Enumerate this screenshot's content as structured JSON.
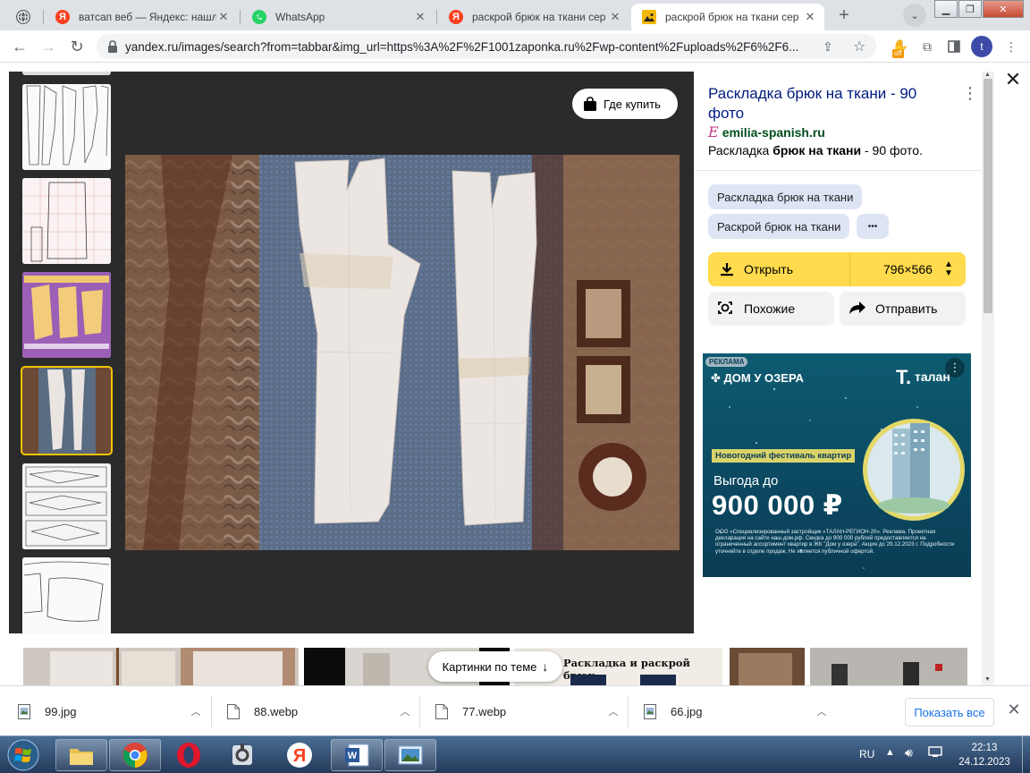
{
  "tabs": [
    {
      "title": "",
      "icon": "globe-icon"
    },
    {
      "title": "ватсап веб — Яндекс: нашло",
      "icon": "yandex-icon"
    },
    {
      "title": "WhatsApp",
      "icon": "whatsapp-icon"
    },
    {
      "title": "раскрой брюк на ткани сер",
      "icon": "yandex-icon"
    },
    {
      "title": "раскрой брюк на ткани сер",
      "icon": "image-icon"
    }
  ],
  "address_bar": {
    "url": "yandex.ru/images/search?from=tabbar&img_url=https%3A%2F%2F1001zaponka.ru%2Fwp-content%2Fuploads%2F6%2F6..."
  },
  "extensions": {
    "badge": "off",
    "profile_initial": "t"
  },
  "viewer": {
    "buy_button": "Где купить",
    "title": "Раскладка брюк на ткани - 90 фото",
    "source": "emilia-spanish.ru",
    "source_icon_glyph": "E",
    "description_prefix": "Раскладка ",
    "description_bold": "брюк на ткани",
    "description_suffix": " - 90 фото.",
    "tags": [
      "Раскладка брюк на ткани",
      "Раскрой брюк на ткани"
    ],
    "more_tags": "•••",
    "open_label": "Открыть",
    "open_size": "796×566",
    "similar_label": "Похожие",
    "share_label": "Отправить",
    "related_button": "Картинки по теме",
    "related_thumb_caption": "Раскладка и раскрой брюк"
  },
  "ad": {
    "badge": "РЕКЛАМА",
    "brand_left": "ДОМ У ОЗЕРА",
    "brand_right": "талан",
    "festival": "Новогодний фестиваль квартир",
    "benefit_label": "Выгода до",
    "amount": "900 000 ₽",
    "legal": "ООО «Специализированный застройщик «ТАЛАН-РЕГИОН-20». Реклама. Проектная декларация на сайте наш.дом.рф. Скидка до 900 000 рублей предоставляется на ограниченный ассортимент квартир в ЖК \"Дом у озера\". Акция до 29.12.2023 г. Подробности уточняйте в отделе продаж. Не является публичной офертой."
  },
  "downloads": [
    {
      "name": "99.jpg",
      "icon": "image-file-icon"
    },
    {
      "name": "88.webp",
      "icon": "file-icon"
    },
    {
      "name": "77.webp",
      "icon": "file-icon"
    },
    {
      "name": "66.jpg",
      "icon": "image-file-icon"
    }
  ],
  "download_bar": {
    "show_all": "Показать все"
  },
  "taskbar": {
    "lang": "RU",
    "time": "22:13",
    "date": "24.12.2023"
  },
  "colors": {
    "yandex_yellow": "#ffdb4d",
    "tag_bg": "#dde5f5",
    "title_blue": "#001a80",
    "source_green": "#004d1a"
  }
}
